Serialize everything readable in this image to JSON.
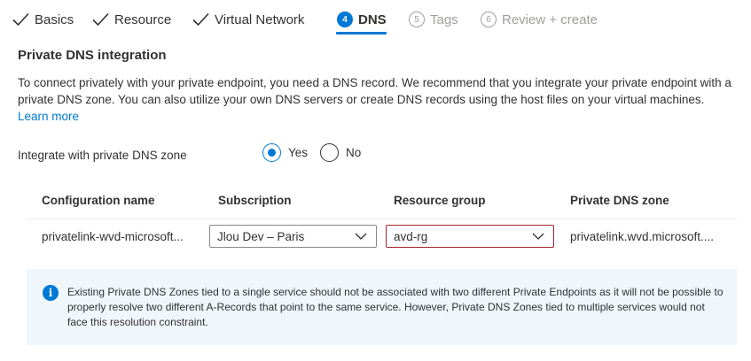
{
  "tabs": [
    {
      "label": "Basics",
      "state": "done"
    },
    {
      "label": "Resource",
      "state": "done"
    },
    {
      "label": "Virtual Network",
      "state": "done"
    },
    {
      "number": "4",
      "label": "DNS",
      "state": "active"
    },
    {
      "number": "5",
      "label": "Tags",
      "state": "disabled"
    },
    {
      "number": "6",
      "label": "Review + create",
      "state": "disabled"
    }
  ],
  "section": {
    "title": "Private DNS integration",
    "description": "To connect privately with your private endpoint, you need a DNS record. We recommend that you integrate your private endpoint with a private DNS zone. You can also utilize your own DNS servers or create DNS records using the host files on your virtual machines.",
    "learn_more": "Learn more"
  },
  "integrate": {
    "label": "Integrate with private DNS zone",
    "options": [
      "Yes",
      "No"
    ],
    "selected": "Yes"
  },
  "table": {
    "headers": [
      "Configuration name",
      "Subscription",
      "Resource group",
      "Private DNS zone"
    ],
    "row": {
      "config_name": "privatelink-wvd-microsoft...",
      "subscription": "Jlou Dev – Paris",
      "resource_group": "avd-rg",
      "dns_zone": "privatelink.wvd.microsoft...."
    }
  },
  "info": {
    "text": "Existing Private DNS Zones tied to a single service should not be associated with two different Private Endpoints as it will not be possible to properly resolve two different A-Records that point to the same service. However, Private DNS Zones tied to multiple services would not face this resolution constraint."
  },
  "colors": {
    "accent": "#0078d4",
    "error_border": "#a4262c",
    "info_background": "#eff6fc",
    "disabled_text": "#a19f9d"
  }
}
